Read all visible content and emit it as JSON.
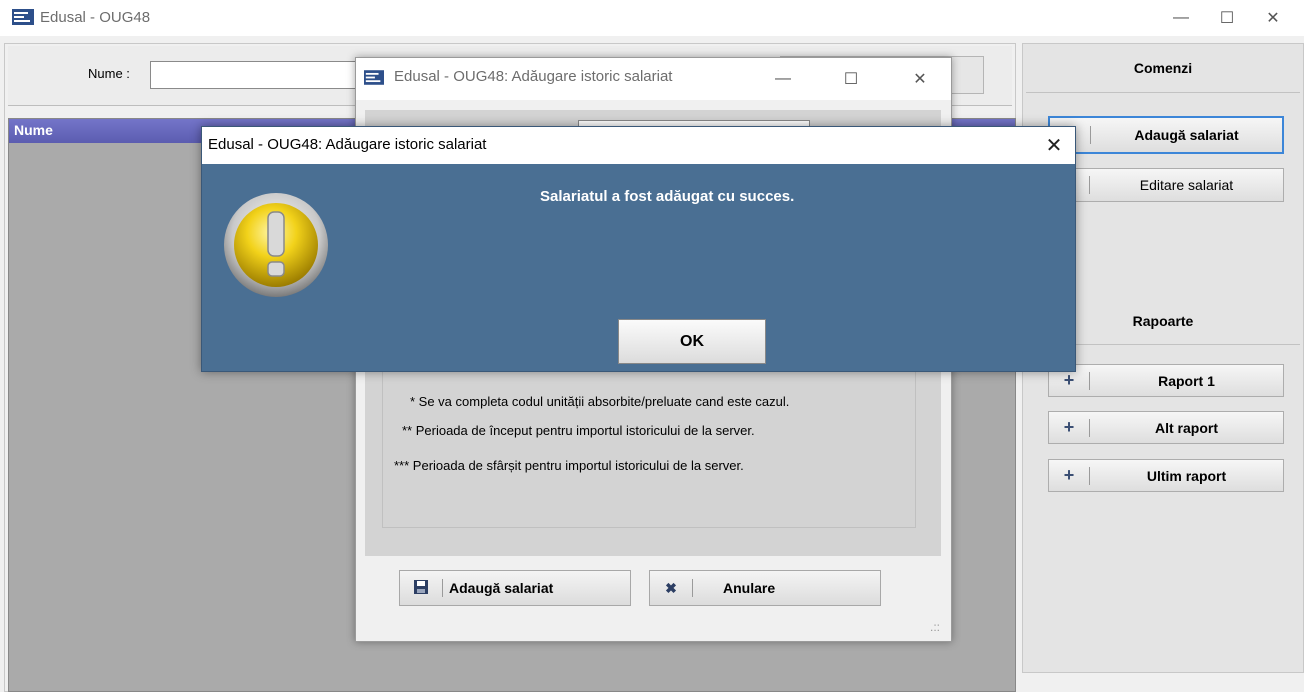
{
  "window": {
    "title": "Edusal - OUG48",
    "controls": {
      "minimize": "—",
      "maximize": "☐",
      "close": "✕"
    }
  },
  "search": {
    "label": "Nume :",
    "value": ""
  },
  "grid": {
    "columns": [
      "Nume"
    ]
  },
  "right_panel": {
    "commands_title": "Comenzi",
    "commands": [
      {
        "label": "Adaugă salariat",
        "icon": "plus-icon"
      },
      {
        "label": "Editare salariat",
        "icon": "plus-icon"
      }
    ],
    "reports_title": "Rapoarte",
    "reports": [
      {
        "label": "Raport 1",
        "icon": "plus-icon"
      },
      {
        "label": "Alt raport",
        "icon": "plus-icon"
      },
      {
        "label": "Ultim raport",
        "icon": "plus-icon"
      }
    ]
  },
  "dialog": {
    "title": "Edusal - OUG48: Adăugare istoric salariat",
    "notes": [
      "* Se va completa codul unității absorbite/preluate cand este cazul.",
      "** Perioada de început pentru importul istoricului de la server.",
      "*** Perioada de sfârșit pentru importul istoricului de la server."
    ],
    "save_button": "Adaugă salariat",
    "cancel_button": "Anulare",
    "save_icon": "save-icon",
    "cancel_icon": "cancel-icon"
  },
  "message_box": {
    "title": "Edusal - OUG48: Adăugare istoric salariat",
    "message": "Salariatul a fost adăugat cu succes.",
    "ok_button": "OK",
    "icon": "warning-icon",
    "close": "✕"
  },
  "colors": {
    "message_box_bg": "#4a6f93",
    "grid_header": "#6a6bbf",
    "focus_border": "#3c86d8"
  }
}
